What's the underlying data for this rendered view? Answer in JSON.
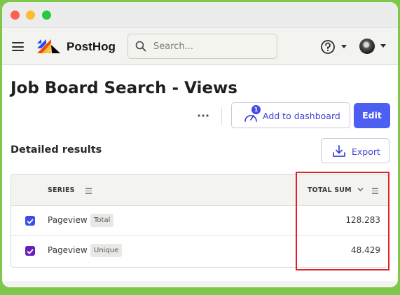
{
  "topbar": {
    "brand": "PostHog",
    "search_placeholder": "Search..."
  },
  "page": {
    "title": "Job Board Search - Views"
  },
  "actions": {
    "add_to_dashboard": "Add to dashboard",
    "dashboard_count": "1",
    "edit": "Edit",
    "export": "Export"
  },
  "results": {
    "section_title": "Detailed results",
    "columns": {
      "series": "SERIES",
      "total_sum": "TOTAL SUM"
    },
    "rows": [
      {
        "name": "Pageview",
        "tag": "Total",
        "value": "128.283",
        "color": "#3d4de8"
      },
      {
        "name": "Pageview",
        "tag": "Unique",
        "value": "48.429",
        "color": "#6a1fb8"
      }
    ]
  },
  "colors": {
    "primary": "#4d5ff2",
    "highlight": "#e0202a"
  }
}
